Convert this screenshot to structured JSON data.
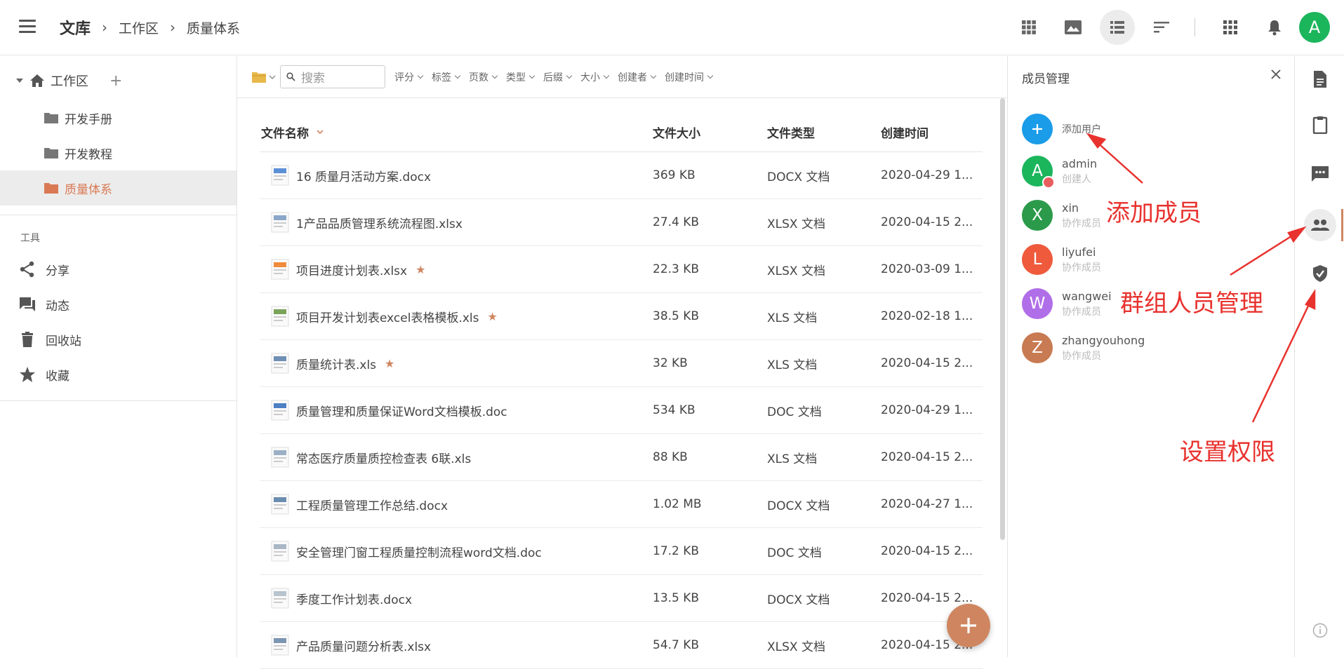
{
  "topbar": {
    "app_title": "文库",
    "breadcrumb": [
      "工作区",
      "质量体系"
    ],
    "avatar_letter": "A",
    "avatar_color": "#1bb55c"
  },
  "sidebar": {
    "workspace_label": "工作区",
    "folders": [
      {
        "label": "开发手册",
        "selected": false
      },
      {
        "label": "开发教程",
        "selected": false
      },
      {
        "label": "质量体系",
        "selected": true
      }
    ],
    "tools_title": "工具",
    "tools": [
      {
        "label": "分享",
        "icon": "share-icon"
      },
      {
        "label": "动态",
        "icon": "activity-icon"
      },
      {
        "label": "回收站",
        "icon": "trash-icon"
      },
      {
        "label": "收藏",
        "icon": "star-icon"
      }
    ]
  },
  "filters": {
    "search_placeholder": "搜索",
    "items": [
      "评分",
      "标签",
      "页数",
      "类型",
      "后缀",
      "大小",
      "创建者",
      "创建时间"
    ]
  },
  "table": {
    "columns": [
      "文件名称",
      "文件大小",
      "文件类型",
      "创建时间"
    ],
    "rows": [
      {
        "name": "16 质量月活动方案.docx",
        "size": "369 KB",
        "type": "DOCX 文档",
        "created": "2020-04-29 1...",
        "starred": false
      },
      {
        "name": "1产品品质管理系统流程图.xlsx",
        "size": "27.4 KB",
        "type": "XLSX 文档",
        "created": "2020-04-15 2...",
        "starred": false
      },
      {
        "name": "项目进度计划表.xlsx",
        "size": "22.3 KB",
        "type": "XLSX 文档",
        "created": "2020-03-09 1...",
        "starred": true
      },
      {
        "name": "项目开发计划表excel表格模板.xls",
        "size": "38.5 KB",
        "type": "XLS 文档",
        "created": "2020-02-18 1...",
        "starred": true
      },
      {
        "name": "质量统计表.xls",
        "size": "32 KB",
        "type": "XLS 文档",
        "created": "2020-04-15 2...",
        "starred": true
      },
      {
        "name": "质量管理和质量保证Word文档模板.doc",
        "size": "534 KB",
        "type": "DOC 文档",
        "created": "2020-04-29 1...",
        "starred": false
      },
      {
        "name": "常态医疗质量质控检查表 6联.xls",
        "size": "88 KB",
        "type": "XLS 文档",
        "created": "2020-04-15 2...",
        "starred": false
      },
      {
        "name": "工程质量管理工作总结.docx",
        "size": "1.02 MB",
        "type": "DOCX 文档",
        "created": "2020-04-27 1...",
        "starred": false
      },
      {
        "name": "安全管理门窗工程质量控制流程word文档.doc",
        "size": "17.2 KB",
        "type": "DOC 文档",
        "created": "2020-04-15 2...",
        "starred": false
      },
      {
        "name": "季度工作计划表.docx",
        "size": "13.5 KB",
        "type": "DOCX 文档",
        "created": "2020-04-15 2...",
        "starred": false
      },
      {
        "name": "产品质量问题分析表.xlsx",
        "size": "54.7 KB",
        "type": "XLSX 文档",
        "created": "2020-04-15 2...",
        "starred": false
      }
    ]
  },
  "panel": {
    "title": "成员管理",
    "add_user_label": "添加用户",
    "members": [
      {
        "name": "admin",
        "role": "创建人",
        "letter": "A",
        "color": "#1bb55c"
      },
      {
        "name": "xin",
        "role": "协作成员",
        "letter": "X",
        "color": "#2b9a4a"
      },
      {
        "name": "liyufei",
        "role": "协作成员",
        "letter": "L",
        "color": "#ef5a3c"
      },
      {
        "name": "wangwei",
        "role": "协作成员",
        "letter": "W",
        "color": "#b06ee8"
      },
      {
        "name": "zhangyouhong",
        "role": "协作成员",
        "letter": "Z",
        "color": "#c87a52"
      }
    ]
  },
  "annotations": {
    "add_member": "添加成员",
    "group_management": "群组人员管理",
    "set_permission": "设置权限"
  },
  "colors": {
    "accent": "#cf8660",
    "annotation": "#e8322e"
  }
}
